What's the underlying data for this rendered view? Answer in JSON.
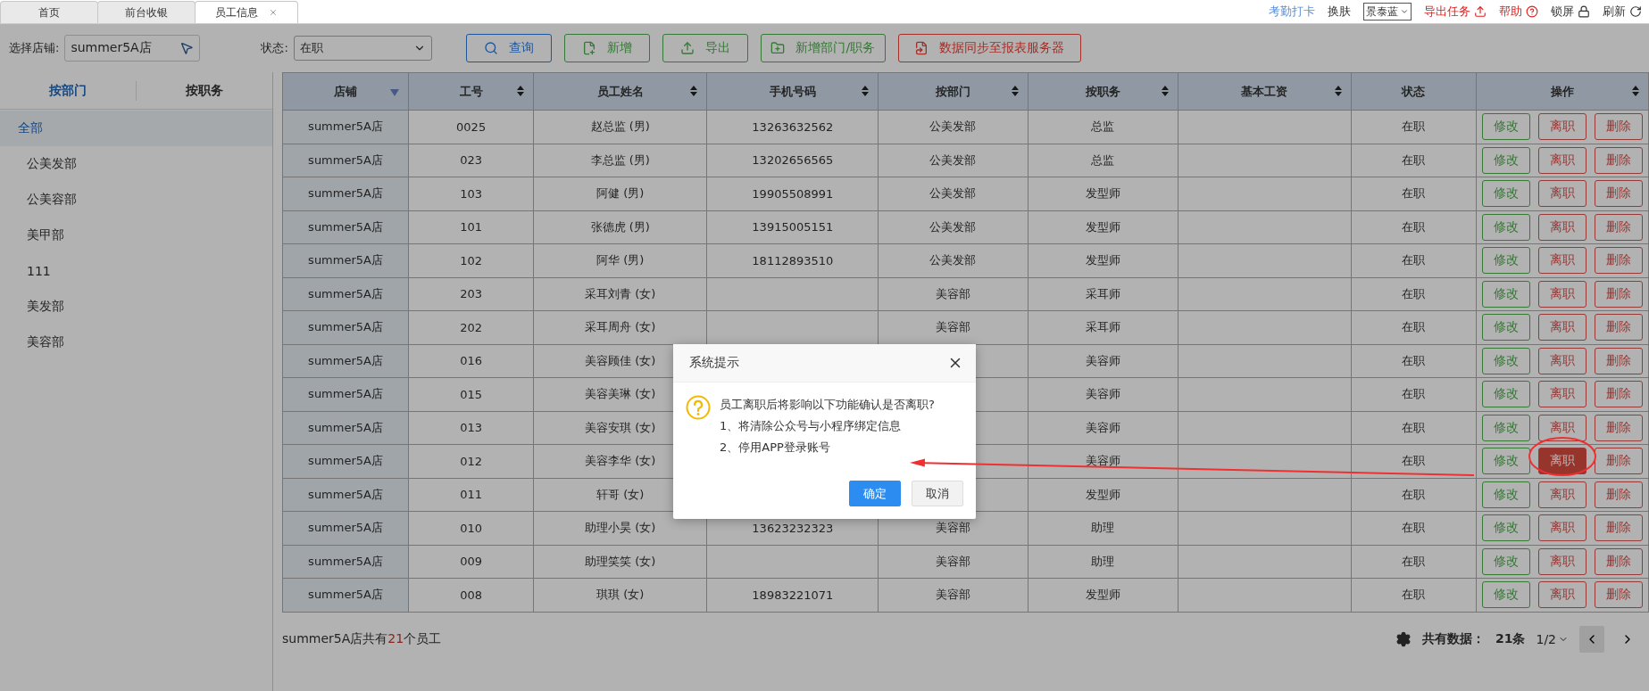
{
  "tabs": [
    {
      "label": "首页",
      "selected": false,
      "closable": false
    },
    {
      "label": "前台收银",
      "selected": false,
      "closable": false
    },
    {
      "label": "员工信息",
      "selected": true,
      "closable": true
    }
  ],
  "top_links": {
    "attendance": "考勤打卡",
    "skin_label": "换肤",
    "skin_value": "景泰蓝",
    "export_tasks": "导出任务",
    "help": "帮助",
    "lock": "锁屏",
    "refresh": "刷新"
  },
  "filters": {
    "store_label": "选择店铺:",
    "store_value": "summer5A店",
    "status_label": "状态:",
    "status_value": "在职"
  },
  "toolbar_buttons": [
    {
      "label": "查询",
      "kind": "search"
    },
    {
      "label": "新增",
      "kind": "add"
    },
    {
      "label": "导出",
      "kind": "export"
    },
    {
      "label": "新增部门/职务",
      "kind": "add_dept"
    },
    {
      "label": "数据同步至报表服务器",
      "kind": "sync"
    }
  ],
  "sidebar": {
    "tabs": [
      {
        "label": "按部门",
        "selected": true
      },
      {
        "label": "按职务",
        "selected": false
      }
    ],
    "items": [
      {
        "label": "全部",
        "selected": true
      },
      {
        "label": "公美发部",
        "selected": false
      },
      {
        "label": "公美容部",
        "selected": false
      },
      {
        "label": "美甲部",
        "selected": false
      },
      {
        "label": "111",
        "selected": false
      },
      {
        "label": "美发部",
        "selected": false
      },
      {
        "label": "美容部",
        "selected": false
      }
    ]
  },
  "table": {
    "columns": [
      {
        "label": "店铺",
        "sortable": true,
        "sorted": true
      },
      {
        "label": "工号",
        "sortable": true,
        "sorted": false
      },
      {
        "label": "员工姓名",
        "sortable": true,
        "sorted": false
      },
      {
        "label": "手机号码",
        "sortable": true,
        "sorted": false
      },
      {
        "label": "按部门",
        "sortable": true,
        "sorted": false
      },
      {
        "label": "按职务",
        "sortable": true,
        "sorted": false
      },
      {
        "label": "基本工资",
        "sortable": true,
        "sorted": false
      },
      {
        "label": "状态",
        "sortable": false
      },
      {
        "label": "操作",
        "sortable": true,
        "sorted": false
      }
    ],
    "rows": [
      {
        "store": "summer5A店",
        "id": "0025",
        "name": "赵总监 (男)",
        "phone": "13263632562",
        "dept": "公美发部",
        "position": "总监",
        "status": "在职",
        "edit": "修改",
        "leave": "离职",
        "delete": "删除",
        "leave_hovered": false
      },
      {
        "store": "summer5A店",
        "id": "023",
        "name": "李总监 (男)",
        "phone": "13202656565",
        "dept": "公美发部",
        "position": "总监",
        "status": "在职",
        "edit": "修改",
        "leave": "离职",
        "delete": "删除",
        "leave_hovered": false
      },
      {
        "store": "summer5A店",
        "id": "103",
        "name": "阿健 (男)",
        "phone": "19905508991",
        "dept": "公美发部",
        "position": "发型师",
        "status": "在职",
        "edit": "修改",
        "leave": "离职",
        "delete": "删除",
        "leave_hovered": false
      },
      {
        "store": "summer5A店",
        "id": "101",
        "name": "张德虎 (男)",
        "phone": "13915005151",
        "dept": "公美发部",
        "position": "发型师",
        "status": "在职",
        "edit": "修改",
        "leave": "离职",
        "delete": "删除",
        "leave_hovered": false
      },
      {
        "store": "summer5A店",
        "id": "102",
        "name": "阿华 (男)",
        "phone": "18112893510",
        "dept": "公美发部",
        "position": "发型师",
        "status": "在职",
        "edit": "修改",
        "leave": "离职",
        "delete": "删除",
        "leave_hovered": false
      },
      {
        "store": "summer5A店",
        "id": "203",
        "name": "采耳刘青 (女)",
        "dept": "美容部",
        "position": "采耳师",
        "status": "在职",
        "edit": "修改",
        "leave": "离职",
        "delete": "删除",
        "leave_hovered": false
      },
      {
        "store": "summer5A店",
        "id": "202",
        "name": "采耳周舟 (女)",
        "dept": "美容部",
        "position": "采耳师",
        "status": "在职",
        "edit": "修改",
        "leave": "离职",
        "delete": "删除",
        "leave_hovered": false
      },
      {
        "store": "summer5A店",
        "id": "016",
        "name": "美容顾佳 (女)",
        "position": "美容师",
        "status": "在职",
        "edit": "修改",
        "leave": "离职",
        "delete": "删除",
        "leave_hovered": false
      },
      {
        "store": "summer5A店",
        "id": "015",
        "name": "美容美琳 (女)",
        "position": "美容师",
        "status": "在职",
        "edit": "修改",
        "leave": "离职",
        "delete": "删除",
        "leave_hovered": false
      },
      {
        "store": "summer5A店",
        "id": "013",
        "name": "美容安琪 (女)",
        "position": "美容师",
        "status": "在职",
        "edit": "修改",
        "leave": "离职",
        "delete": "删除",
        "leave_hovered": false
      },
      {
        "store": "summer5A店",
        "id": "012",
        "name": "美容李华 (女)",
        "position": "美容师",
        "status": "在职",
        "edit": "修改",
        "leave": "离职",
        "delete": "删除",
        "leave_hovered": true
      },
      {
        "store": "summer5A店",
        "id": "011",
        "name": "轩哥 (女)",
        "position": "发型师",
        "status": "在职",
        "edit": "修改",
        "leave": "离职",
        "delete": "删除",
        "leave_hovered": false
      },
      {
        "store": "summer5A店",
        "id": "010",
        "name": "助理小昊 (女)",
        "phone": "13623232323",
        "dept": "美容部",
        "position": "助理",
        "status": "在职",
        "edit": "修改",
        "leave": "离职",
        "delete": "删除",
        "leave_hovered": false
      },
      {
        "store": "summer5A店",
        "id": "009",
        "name": "助理笑笑 (女)",
        "dept": "美容部",
        "position": "助理",
        "status": "在职",
        "edit": "修改",
        "leave": "离职",
        "delete": "删除",
        "leave_hovered": false
      },
      {
        "store": "summer5A店",
        "id": "008",
        "name": "琪琪 (女)",
        "phone": "18983221071",
        "dept": "美容部",
        "position": "发型师",
        "status": "在职",
        "edit": "修改",
        "leave": "离职",
        "delete": "删除",
        "leave_hovered": false
      }
    ]
  },
  "summary": {
    "before": "summer5A店共有",
    "count": "21",
    "after": "个员工"
  },
  "pagination": {
    "total_label": "共有数据：",
    "total_value": "21条",
    "page": "1/2"
  },
  "dialog": {
    "title": "系统提示",
    "lines": [
      "员工离职后将影响以下功能确认是否离职?",
      "1、将清除公众号与小程序绑定信息",
      "2、停用APP登录账号"
    ],
    "confirm": "确定",
    "cancel": "取消"
  }
}
